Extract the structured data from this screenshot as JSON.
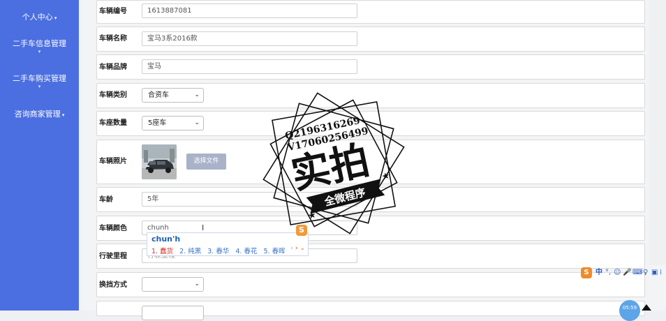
{
  "sidebar": {
    "items": [
      {
        "label": "个人中心"
      },
      {
        "label": "二手车信息管理"
      },
      {
        "label": "二手车购买管理"
      },
      {
        "label": "咨询商家管理"
      }
    ]
  },
  "form": {
    "vehicle_no": {
      "label": "车辆编号",
      "value": "1613887081"
    },
    "vehicle_name": {
      "label": "车辆名称",
      "value": "宝马3系2016款"
    },
    "brand": {
      "label": "车辆品牌",
      "value": "宝马"
    },
    "category": {
      "label": "车辆类别",
      "value": "合资车"
    },
    "seats": {
      "label": "车座数量",
      "value": "5座车"
    },
    "photo": {
      "label": "车辆照片",
      "button": "选择文件"
    },
    "age": {
      "label": "车龄",
      "value": "5年"
    },
    "color": {
      "label": "车辆颜色",
      "value": "chunh"
    },
    "mileage": {
      "label": "行驶里程",
      "placeholder": "行驶里程"
    },
    "transmission": {
      "label": "换挡方式",
      "value": ""
    }
  },
  "ime": {
    "composition": "chun'h",
    "candidates": [
      "1. 蠢货",
      "2. 纯黑",
      "3. 春华",
      "4. 春花",
      "5. 春晖"
    ]
  },
  "watermark": {
    "contact_q": "Q2196316269",
    "contact_v": "V17060256499",
    "main": "实拍",
    "ribbon": "全微程序"
  },
  "tray": {
    "lang": "中",
    "time": "05:59"
  },
  "colors": {
    "sidebar": "#4b6fe0",
    "ime_accent": "#f08b2c"
  }
}
